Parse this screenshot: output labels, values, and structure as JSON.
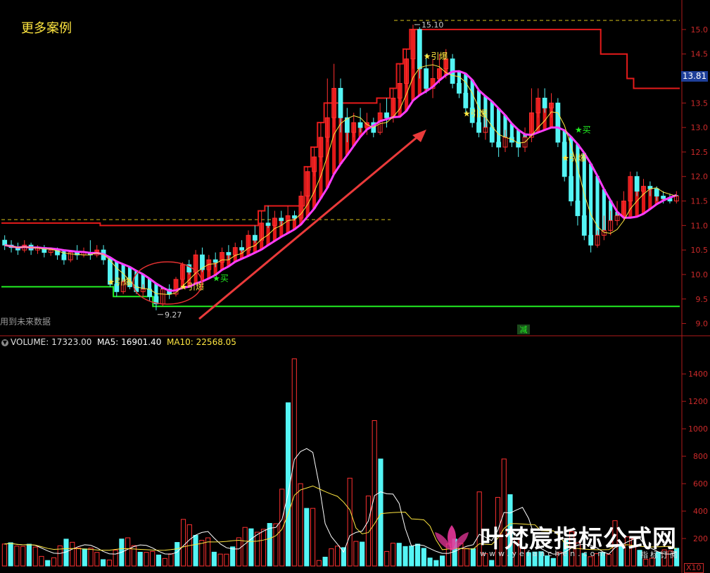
{
  "corner_title": "更多案例",
  "future_note": "用到未来数据",
  "current_price": "13.81",
  "volume_header": {
    "volume": "VOLUME: 17323.00",
    "ma5": "MA5: 16901.40",
    "ma10": "MA10: 22568.05"
  },
  "watermark": {
    "title": "叶梵宸指标公式网",
    "url": "www.yefanchen.com",
    "sub": "指标订阅"
  },
  "x10_label": "X10",
  "colors": {
    "up": "#e01818",
    "down": "#54f5f5",
    "magenta": "#ff3cff",
    "green": "#22ee22",
    "yellow": "#ffe640",
    "axis": "#b01a1a"
  },
  "chart_data": [
    {
      "type": "candlestick",
      "title": "",
      "y_axis": {
        "ticks": [
          "9.0",
          "9.5",
          "10.0",
          "10.5",
          "11.0",
          "11.5",
          "12.0",
          "12.5",
          "13.0",
          "13.5",
          "14.0",
          "14.5",
          "15.0"
        ],
        "ylim": [
          8.85,
          15.2
        ]
      },
      "markers": [
        {
          "text": "15.10",
          "value": 15.1,
          "kind": "high"
        },
        {
          "text": "9.27",
          "value": 9.27,
          "kind": "low"
        }
      ],
      "annotations": [
        "★引爆",
        "★引爆",
        "★买",
        "★引爆",
        "★引爆",
        "★买",
        "★引爆"
      ],
      "bottom_label": "减",
      "series": [
        {
          "name": "",
          "kind": "ohlc"
        },
        {
          "name": "",
          "kind": "upper-band"
        },
        {
          "name": "",
          "kind": "lower-band"
        }
      ],
      "candles": [
        [
          10.7,
          10.6,
          10.8,
          10.5
        ],
        [
          10.6,
          10.55,
          10.7,
          10.45
        ],
        [
          10.55,
          10.5,
          10.65,
          10.4
        ],
        [
          10.5,
          10.6,
          10.7,
          10.45
        ],
        [
          10.6,
          10.5,
          10.65,
          10.4
        ],
        [
          10.5,
          10.55,
          10.6,
          10.42
        ],
        [
          10.55,
          10.45,
          10.6,
          10.35
        ],
        [
          10.45,
          10.5,
          10.55,
          10.38
        ],
        [
          10.5,
          10.4,
          10.55,
          10.3
        ],
        [
          10.4,
          10.3,
          10.5,
          10.2
        ],
        [
          10.3,
          10.45,
          10.5,
          10.25
        ],
        [
          10.45,
          10.4,
          10.6,
          10.3
        ],
        [
          10.4,
          10.45,
          10.55,
          10.35
        ],
        [
          10.45,
          10.4,
          10.7,
          10.3
        ],
        [
          10.4,
          10.5,
          10.6,
          10.35
        ],
        [
          10.5,
          10.3,
          10.6,
          10.2
        ],
        [
          10.3,
          9.8,
          10.35,
          9.75
        ],
        [
          9.8,
          9.65,
          9.95,
          9.55
        ],
        [
          9.65,
          9.85,
          9.9,
          9.6
        ],
        [
          9.85,
          9.75,
          9.95,
          9.7
        ],
        [
          9.75,
          9.65,
          9.85,
          9.6
        ],
        [
          9.65,
          9.7,
          9.8,
          9.55
        ],
        [
          9.7,
          9.55,
          9.75,
          9.45
        ],
        [
          9.55,
          9.4,
          9.6,
          9.27
        ],
        [
          9.4,
          9.7,
          9.75,
          9.35
        ],
        [
          9.7,
          9.6,
          9.8,
          9.5
        ],
        [
          9.6,
          9.9,
          9.95,
          9.55
        ],
        [
          9.9,
          10.2,
          10.25,
          9.85
        ],
        [
          10.2,
          10.05,
          10.3,
          10.0
        ],
        [
          10.05,
          10.4,
          10.5,
          10.0
        ],
        [
          10.4,
          10.1,
          10.55,
          10.05
        ],
        [
          10.1,
          10.3,
          10.4,
          10.05
        ],
        [
          10.3,
          10.25,
          10.45,
          10.15
        ],
        [
          10.25,
          10.45,
          10.55,
          10.2
        ],
        [
          10.45,
          10.4,
          10.6,
          10.3
        ],
        [
          10.4,
          10.55,
          10.65,
          10.35
        ],
        [
          10.55,
          10.5,
          10.7,
          10.45
        ],
        [
          10.5,
          10.8,
          10.9,
          10.45
        ],
        [
          10.8,
          10.7,
          11.0,
          10.65
        ],
        [
          10.7,
          11.05,
          11.3,
          10.7
        ],
        [
          11.05,
          11.0,
          11.4,
          10.95
        ],
        [
          11.0,
          11.15,
          11.3,
          10.95
        ],
        [
          11.15,
          11.1,
          11.3,
          11.0
        ],
        [
          11.1,
          11.2,
          11.4,
          11.05
        ],
        [
          11.2,
          11.15,
          11.3,
          11.1
        ],
        [
          11.15,
          11.6,
          11.7,
          11.1
        ],
        [
          11.6,
          12.1,
          12.2,
          11.5
        ],
        [
          12.1,
          12.4,
          12.6,
          12.0
        ],
        [
          12.4,
          12.8,
          13.1,
          12.3
        ],
        [
          12.8,
          13.2,
          14.0,
          12.7
        ],
        [
          13.2,
          13.8,
          14.3,
          13.0
        ],
        [
          13.8,
          13.2,
          14.0,
          12.9
        ],
        [
          13.2,
          12.9,
          13.4,
          12.7
        ],
        [
          12.9,
          13.1,
          13.3,
          12.8
        ],
        [
          13.1,
          13.0,
          13.4,
          12.9
        ],
        [
          13.0,
          13.1,
          13.3,
          12.85
        ],
        [
          13.1,
          12.9,
          13.2,
          12.8
        ],
        [
          12.9,
          13.3,
          13.5,
          12.85
        ],
        [
          13.3,
          13.2,
          13.6,
          13.0
        ],
        [
          13.2,
          13.6,
          13.8,
          13.1
        ],
        [
          13.6,
          13.9,
          14.3,
          13.5
        ],
        [
          13.9,
          14.4,
          14.6,
          13.8
        ],
        [
          14.4,
          15.0,
          15.1,
          14.2
        ],
        [
          15.0,
          14.2,
          15.05,
          14.0
        ],
        [
          14.2,
          13.8,
          14.5,
          13.7
        ],
        [
          13.8,
          14.0,
          14.4,
          13.6
        ],
        [
          14.0,
          14.2,
          14.5,
          13.9
        ],
        [
          14.2,
          14.4,
          14.6,
          14.0
        ],
        [
          14.4,
          13.9,
          14.5,
          13.8
        ],
        [
          13.9,
          13.7,
          14.1,
          13.6
        ],
        [
          13.7,
          13.4,
          13.8,
          13.3
        ],
        [
          13.4,
          13.1,
          13.5,
          13.0
        ],
        [
          13.1,
          12.9,
          13.2,
          12.8
        ],
        [
          12.9,
          13.0,
          13.2,
          12.75
        ],
        [
          13.0,
          12.7,
          13.1,
          12.6
        ],
        [
          12.7,
          12.6,
          12.85,
          12.4
        ],
        [
          12.6,
          12.8,
          12.95,
          12.5
        ],
        [
          12.8,
          12.7,
          12.9,
          12.6
        ],
        [
          12.7,
          12.6,
          12.8,
          12.4
        ],
        [
          12.6,
          12.8,
          13.0,
          12.5
        ],
        [
          12.8,
          13.3,
          13.8,
          12.7
        ],
        [
          13.3,
          13.6,
          13.8,
          13.2
        ],
        [
          13.6,
          13.4,
          13.8,
          13.3
        ],
        [
          13.4,
          13.5,
          13.7,
          13.2
        ],
        [
          13.5,
          12.7,
          13.6,
          12.6
        ],
        [
          12.7,
          12.0,
          12.8,
          11.9
        ],
        [
          12.0,
          11.5,
          12.1,
          11.4
        ],
        [
          11.5,
          11.2,
          11.6,
          11.0
        ],
        [
          11.2,
          10.8,
          11.3,
          10.7
        ],
        [
          10.8,
          10.6,
          10.9,
          10.45
        ],
        [
          10.6,
          10.8,
          10.9,
          10.55
        ],
        [
          10.8,
          10.9,
          11.2,
          10.7
        ],
        [
          10.9,
          11.1,
          11.3,
          10.8
        ],
        [
          11.1,
          11.2,
          11.5,
          11.0
        ],
        [
          11.2,
          11.5,
          11.7,
          11.1
        ],
        [
          11.5,
          12.0,
          12.1,
          11.4
        ],
        [
          12.0,
          11.7,
          12.1,
          11.6
        ],
        [
          11.7,
          11.8,
          11.95,
          11.6
        ],
        [
          11.8,
          11.75,
          11.9,
          11.6
        ],
        [
          11.75,
          11.6,
          11.8,
          11.5
        ],
        [
          11.6,
          11.55,
          11.7,
          11.45
        ],
        [
          11.55,
          11.5,
          11.65,
          11.45
        ],
        [
          11.5,
          11.6,
          11.7,
          11.45
        ]
      ],
      "upper_band": [
        11.05,
        11.05,
        11.05,
        11.05,
        11.05,
        11.05,
        11.05,
        11.05,
        11.05,
        11.05,
        11.05,
        11.05,
        11.05,
        11.05,
        11.05,
        11.0,
        11.0,
        11.0,
        11.0,
        11.0,
        11.0,
        11.0,
        11.0,
        11.0,
        11.0,
        11.0,
        11.0,
        11.0,
        11.0,
        11.0,
        11.0,
        11.0,
        11.0,
        11.0,
        11.0,
        11.0,
        11.0,
        11.0,
        11.0,
        11.3,
        11.4,
        11.4,
        11.4,
        11.4,
        11.4,
        11.4,
        12.2,
        12.6,
        13.1,
        13.5,
        13.5,
        13.5,
        13.5,
        13.5,
        13.5,
        13.5,
        13.5,
        13.6,
        13.6,
        13.8,
        14.3,
        14.6,
        15.0,
        15.0,
        15.0,
        15.0,
        15.0,
        15.0,
        15.0,
        15.0,
        15.0,
        15.0,
        15.0,
        15.0,
        15.0,
        15.0,
        15.0,
        15.0,
        15.0,
        15.0,
        15.0,
        15.0,
        15.0,
        15.0,
        15.0,
        15.0,
        15.0,
        15.0,
        15.0,
        15.0,
        15.0,
        14.5,
        14.5,
        14.5,
        14.5,
        14.0,
        13.8,
        13.8,
        13.8,
        13.8,
        13.8,
        13.8,
        13.8
      ],
      "lower_band": [
        9.75,
        9.75,
        9.75,
        9.75,
        9.75,
        9.75,
        9.75,
        9.75,
        9.75,
        9.75,
        9.75,
        9.75,
        9.75,
        9.75,
        9.75,
        9.75,
        9.75,
        9.55,
        9.55,
        9.55,
        9.55,
        9.55,
        9.55,
        9.35,
        9.35,
        9.35,
        9.35,
        9.35,
        9.35,
        9.35,
        9.35,
        9.35,
        9.35,
        9.35,
        9.35,
        9.35,
        9.35,
        9.35,
        9.35,
        9.35,
        9.35,
        9.35,
        9.35,
        9.35,
        9.35,
        9.35,
        9.35,
        9.35,
        9.35,
        9.35,
        9.35,
        9.35,
        9.35,
        9.35,
        9.35,
        9.35,
        9.35,
        9.35,
        9.35,
        9.35,
        9.35,
        9.35,
        9.35,
        9.35,
        9.35,
        9.35,
        9.35,
        9.35,
        9.35,
        9.35,
        9.35,
        9.35,
        9.35,
        9.35,
        9.35,
        9.35,
        9.35,
        9.35,
        9.35,
        9.35,
        9.35,
        9.35,
        9.35,
        9.35,
        9.35,
        9.35,
        9.35,
        9.35,
        9.35,
        9.35,
        9.35,
        9.35,
        9.35,
        9.35,
        9.35,
        9.35,
        9.35,
        9.35,
        9.35,
        9.35,
        9.35,
        9.35,
        9.35
      ]
    },
    {
      "type": "bar",
      "title": "",
      "y_axis": {
        "ticks": [
          "200",
          "400",
          "600",
          "800",
          "1000",
          "1200",
          "1400"
        ],
        "ylim": [
          0,
          1560
        ]
      },
      "bar_count": 110
    }
  ]
}
